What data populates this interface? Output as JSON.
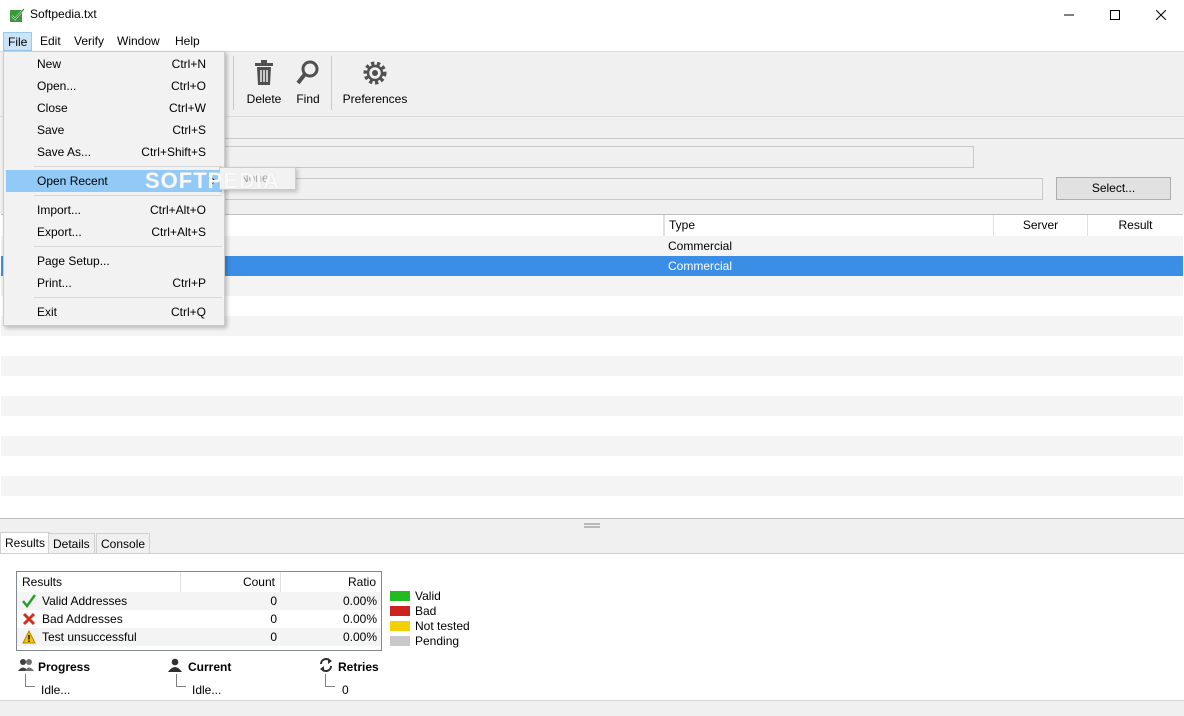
{
  "window": {
    "title": "Softpedia.txt"
  },
  "menubar": [
    "File",
    "Edit",
    "Verify",
    "Window",
    "Help"
  ],
  "toolbar": {
    "delete_label": "Delete",
    "find_label": "Find",
    "preferences_label": "Preferences"
  },
  "form": {
    "select_label": "Select..."
  },
  "table": {
    "columns": [
      "Type",
      "Server",
      "Result"
    ],
    "rows": [
      {
        "type": "Commercial",
        "selected": false
      },
      {
        "type": "Commercial",
        "selected": true
      }
    ]
  },
  "file_menu": {
    "items": [
      {
        "label": "New",
        "shortcut": "Ctrl+N"
      },
      {
        "label": "Open...",
        "shortcut": "Ctrl+O"
      },
      {
        "label": "Close",
        "shortcut": "Ctrl+W"
      },
      {
        "label": "Save",
        "shortcut": "Ctrl+S"
      },
      {
        "label": "Save As...",
        "shortcut": "Ctrl+Shift+S"
      },
      {
        "label": "Open Recent",
        "shortcut": ""
      },
      {
        "label": "Import...",
        "shortcut": "Ctrl+Alt+O"
      },
      {
        "label": "Export...",
        "shortcut": "Ctrl+Alt+S"
      },
      {
        "label": "Page Setup...",
        "shortcut": ""
      },
      {
        "label": "Print...",
        "shortcut": "Ctrl+P"
      },
      {
        "label": "Exit",
        "shortcut": "Ctrl+Q"
      }
    ],
    "submenu_none": "None"
  },
  "watermark": "SOFTPEDIA",
  "bottom_tabs": [
    "Results",
    "Details",
    "Console"
  ],
  "results": {
    "headers": [
      "Results",
      "Count",
      "Ratio"
    ],
    "rows": [
      {
        "label": "Valid Addresses",
        "count": "0",
        "ratio": "0.00%",
        "icon": "check-icon"
      },
      {
        "label": "Bad Addresses",
        "count": "0",
        "ratio": "0.00%",
        "icon": "x-icon"
      },
      {
        "label": "Test unsuccessful",
        "count": "0",
        "ratio": "0.00%",
        "icon": "warning-icon"
      }
    ]
  },
  "legend": [
    {
      "label": "Valid",
      "color": "#22bb22"
    },
    {
      "label": "Bad",
      "color": "#cc2222"
    },
    {
      "label": "Not tested",
      "color": "#f5d000"
    },
    {
      "label": "Pending",
      "color": "#c8c8c8"
    }
  ],
  "stats": {
    "progress": {
      "title": "Progress",
      "value": "Idle..."
    },
    "current": {
      "title": "Current",
      "value": "Idle..."
    },
    "retries": {
      "title": "Retries",
      "value": "0"
    }
  },
  "colors": {
    "selection": "#3a8ee6",
    "menu_highlight": "#91c9f7"
  }
}
